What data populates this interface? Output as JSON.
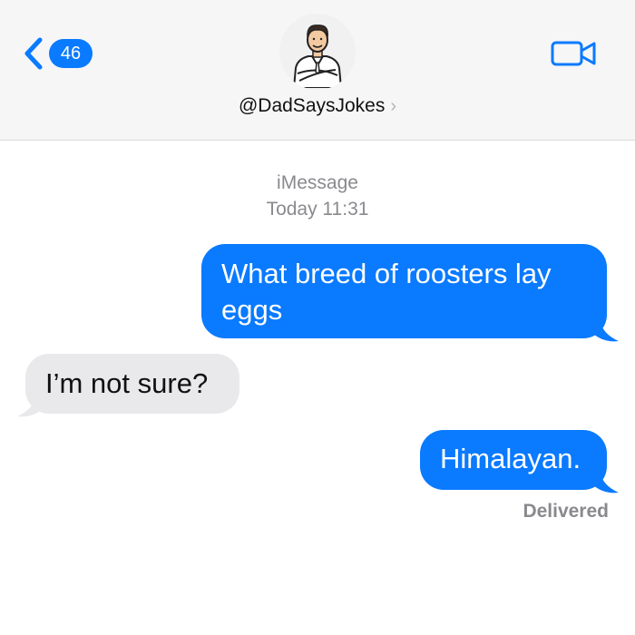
{
  "header": {
    "back_count": "46",
    "contact_name": "@DadSaysJokes",
    "contact_chevron": "›",
    "icons": {
      "back": "chevron-left-icon",
      "video": "video-camera-icon",
      "avatar": "avatar"
    },
    "accent_color": "#0a7aff"
  },
  "thread": {
    "service_label": "iMessage",
    "timestamp": "Today 11:31",
    "messages": [
      {
        "direction": "outgoing",
        "text": "What breed of roosters lay eggs"
      },
      {
        "direction": "incoming",
        "text": "I’m not sure?"
      },
      {
        "direction": "outgoing",
        "text": "Himalayan."
      }
    ],
    "status": "Delivered"
  },
  "colors": {
    "outgoing_bubble": "#0a7aff",
    "incoming_bubble": "#e9e9eb",
    "meta_text": "#8a8a8e"
  }
}
